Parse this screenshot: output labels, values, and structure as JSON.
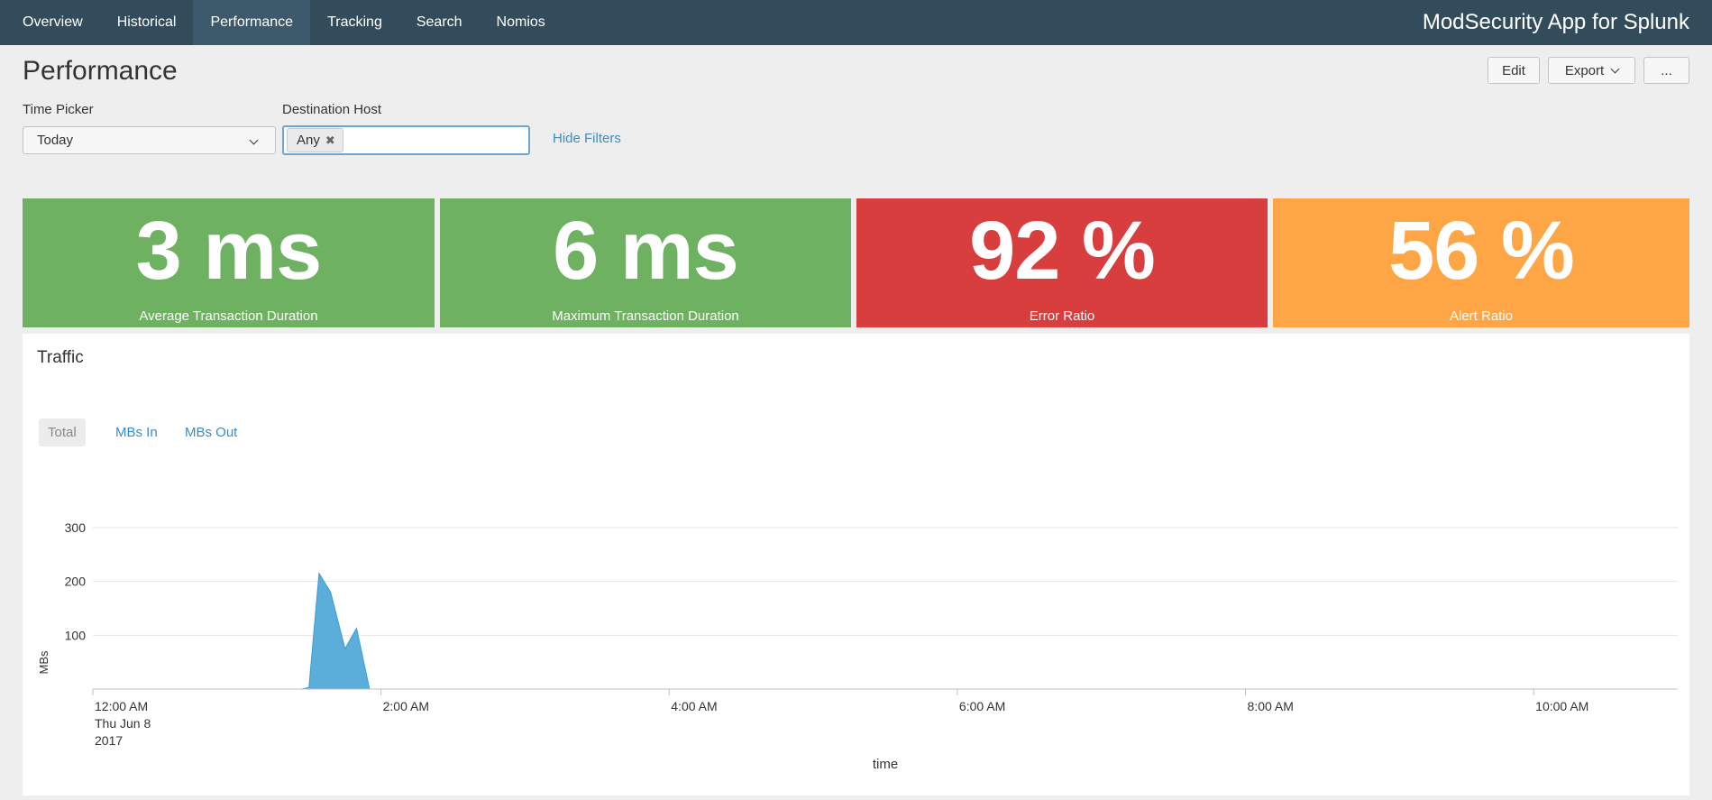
{
  "nav": {
    "items": [
      {
        "label": "Overview",
        "name": "nav-item-overview",
        "active": false
      },
      {
        "label": "Historical",
        "name": "nav-item-historical",
        "active": false
      },
      {
        "label": "Performance",
        "name": "nav-item-performance",
        "active": true
      },
      {
        "label": "Tracking",
        "name": "nav-item-tracking",
        "active": false
      },
      {
        "label": "Search",
        "name": "nav-item-search",
        "active": false
      },
      {
        "label": "Nomios",
        "name": "nav-item-nomios",
        "active": false
      }
    ],
    "app_title": "ModSecurity App for Splunk"
  },
  "header": {
    "title": "Performance",
    "edit_label": "Edit",
    "export_label": "Export",
    "more_label": "..."
  },
  "filters": {
    "time_picker_label": "Time Picker",
    "time_picker_value": "Today",
    "dest_host_label": "Destination Host",
    "dest_host_token": "Any",
    "hide_filters_label": "Hide Filters"
  },
  "single_values": [
    {
      "value": "3 ms",
      "label": "Average Transaction Duration",
      "color": "#6db161"
    },
    {
      "value": "6 ms",
      "label": "Maximum Transaction Duration",
      "color": "#6db161"
    },
    {
      "value": "92 %",
      "label": "Error Ratio",
      "color": "#d93e3e"
    },
    {
      "value": "56 %",
      "label": "Alert Ratio",
      "color": "#fea646"
    }
  ],
  "traffic": {
    "title": "Traffic",
    "tabs": [
      {
        "label": "Total",
        "active": true
      },
      {
        "label": "MBs In",
        "active": false
      },
      {
        "label": "MBs Out",
        "active": false
      }
    ]
  },
  "chart_data": {
    "type": "area",
    "xlabel": "time",
    "ylabel": "MBs",
    "ylim": [
      0,
      300
    ],
    "yticks": [
      100,
      200,
      300
    ],
    "xlim_hours": [
      0,
      11
    ],
    "xticks": [
      {
        "hour": 0,
        "label": [
          "12:00 AM",
          "Thu Jun 8",
          "2017"
        ]
      },
      {
        "hour": 2,
        "label": [
          "2:00 AM"
        ]
      },
      {
        "hour": 4,
        "label": [
          "4:00 AM"
        ]
      },
      {
        "hour": 6,
        "label": [
          "6:00 AM"
        ]
      },
      {
        "hour": 8,
        "label": [
          "8:00 AM"
        ]
      },
      {
        "hour": 10,
        "label": [
          "10:00 AM"
        ]
      }
    ],
    "series": [
      {
        "color": "#5aaed9",
        "points": [
          {
            "x": 0,
            "y": 0
          },
          {
            "x": 1.45,
            "y": 0
          },
          {
            "x": 1.5,
            "y": 3
          },
          {
            "x": 1.57,
            "y": 215
          },
          {
            "x": 1.65,
            "y": 180
          },
          {
            "x": 1.75,
            "y": 75
          },
          {
            "x": 1.83,
            "y": 113
          },
          {
            "x": 1.92,
            "y": 0
          },
          {
            "x": 10.75,
            "y": 0
          }
        ]
      }
    ],
    "grid": true
  }
}
